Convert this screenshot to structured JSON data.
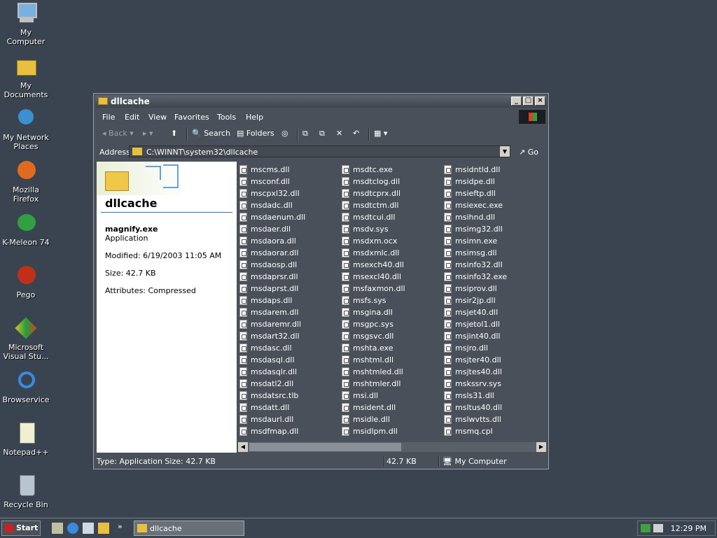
{
  "desktop": {
    "icons": [
      {
        "label": "My Computer"
      },
      {
        "label": "My Documents"
      },
      {
        "label": "My Network Places"
      },
      {
        "label": "Mozilla Firefox"
      },
      {
        "label": "K-Meleon 74"
      },
      {
        "label": "Pego"
      },
      {
        "label": "Microsoft Visual Stu..."
      },
      {
        "label": "Browservice"
      },
      {
        "label": "Notepad++"
      },
      {
        "label": "Recycle Bin"
      }
    ]
  },
  "window": {
    "title": "dllcache",
    "menu": [
      "File",
      "Edit",
      "View",
      "Favorites",
      "Tools",
      "Help"
    ],
    "toolbar": {
      "back": "Back",
      "search": "Search",
      "folders": "Folders"
    },
    "address": {
      "label": "Address",
      "value": "C:\\WINNT\\system32\\dllcache",
      "go": "Go"
    },
    "info": {
      "folder_title": "dllcache",
      "file_name": "magnify.exe",
      "file_type": "Application",
      "modified": "Modified: 6/19/2003 11:05 AM",
      "size": "Size: 42.7 KB",
      "attributes": "Attributes: Compressed"
    },
    "files": {
      "col1": [
        "mscms.dll",
        "msconf.dll",
        "mscpxl32.dll",
        "msdadc.dll",
        "msdaenum.dll",
        "msdaer.dll",
        "msdaora.dll",
        "msdaorar.dll",
        "msdaosp.dll",
        "msdaprsr.dll",
        "msdaprst.dll",
        "msdaps.dll",
        "msdarem.dll",
        "msdaremr.dll",
        "msdart32.dll",
        "msdasc.dll",
        "msdasql.dll",
        "msdasqlr.dll",
        "msdatl2.dll",
        "msdatsrc.tlb",
        "msdatt.dll",
        "msdaurl.dll",
        "msdfmap.dll"
      ],
      "col2": [
        "msdtc.exe",
        "msdtclog.dll",
        "msdtcprx.dll",
        "msdtctm.dll",
        "msdtcui.dll",
        "msdv.sys",
        "msdxm.ocx",
        "msdxmlc.dll",
        "msexch40.dll",
        "msexcl40.dll",
        "msfaxmon.dll",
        "msfs.sys",
        "msgina.dll",
        "msgpc.sys",
        "msgsvc.dll",
        "mshta.exe",
        "mshtml.dll",
        "mshtmled.dll",
        "mshtmler.dll",
        "msi.dll",
        "msident.dll",
        "msidle.dll",
        "msidlpm.dll"
      ],
      "col3": [
        "msidntld.dll",
        "msidpe.dll",
        "msieftp.dll",
        "msiexec.exe",
        "msihnd.dll",
        "msimg32.dll",
        "msimn.exe",
        "msimsg.dll",
        "msinfo32.dll",
        "msinfo32.exe",
        "msiprov.dll",
        "msir2jp.dll",
        "msjet40.dll",
        "msjetol1.dll",
        "msjint40.dll",
        "msjro.dll",
        "msjter40.dll",
        "msjtes40.dll",
        "mskssrv.sys",
        "msls31.dll",
        "msltus40.dll",
        "mslwvtts.dll",
        "msmq.cpl"
      ]
    },
    "status": {
      "left": "Type: Application Size: 42.7 KB",
      "size": "42.7 KB",
      "zone": "My Computer"
    }
  },
  "taskbar": {
    "start": "Start",
    "task": "dllcache",
    "clock": "12:29 PM"
  }
}
